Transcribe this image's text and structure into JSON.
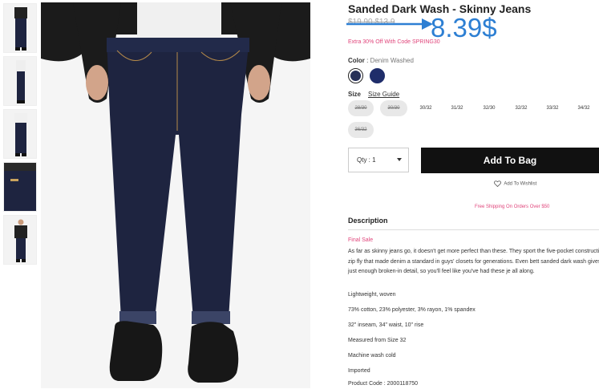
{
  "product": {
    "title": "Sanded Dark Wash - Skinny Jeans",
    "old_price": "$19.90 $13.9",
    "new_price": "8.39$",
    "promo": "Extra 30% Off With Code SPRING30"
  },
  "color": {
    "label": "Color",
    "value": "Denim Washed",
    "swatches": [
      "dark-denim",
      "navy"
    ],
    "swatch_colors": [
      "#263059",
      "#1f2d6a"
    ]
  },
  "size": {
    "label": "Size",
    "guide": "Size Guide",
    "options": [
      {
        "label": "28/30",
        "available": false
      },
      {
        "label": "30/30",
        "available": false
      },
      {
        "label": "30/32",
        "available": true
      },
      {
        "label": "31/32",
        "available": true
      },
      {
        "label": "32/30",
        "available": true
      },
      {
        "label": "32/32",
        "available": true
      },
      {
        "label": "33/32",
        "available": true
      },
      {
        "label": "34/32",
        "available": true
      },
      {
        "label": "36/32",
        "available": false
      }
    ]
  },
  "qty_label": "Qty : 1",
  "add_to_bag": "Add To Bag",
  "wishlist": "Add To Wishlist",
  "shipping": "Free Shipping On Orders Over $50",
  "description": {
    "heading": "Description",
    "final_sale": "Final Sale",
    "body": "As far as skinny jeans go, it doesn't get more perfect than these. They sport the five-pocket construction and zip fly that made denim a standard in guys' closets for generations. Even bett sanded dark wash gives you just enough broken-in detail, so you'll feel like you've had these je all along.",
    "specs": [
      "Lightweight, woven",
      "73% cotton, 23% polyester, 3% rayon, 1% spandex",
      "32\" inseam, 34\" waist, 10\" rise",
      "Measured from Size 32",
      "Machine wash cold",
      "Imported",
      "Product Code : 2000118750"
    ]
  },
  "colors": {
    "accent_price": "#2d7fd3",
    "promo_pink": "#e0457b",
    "button_black": "#111111"
  }
}
